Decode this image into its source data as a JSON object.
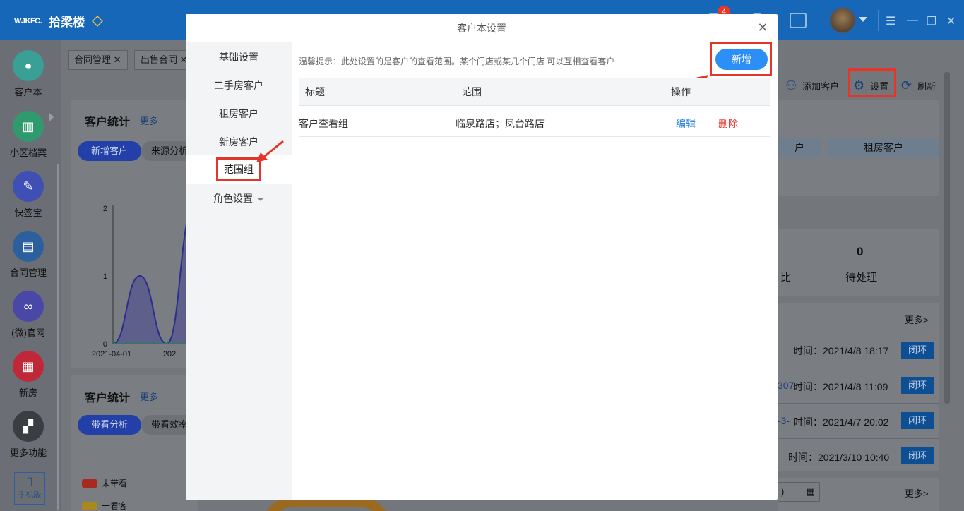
{
  "app": {
    "logo_mark": "WJKFC.",
    "name": "拾梁楼",
    "notification_count": "4"
  },
  "sidebar": {
    "items": [
      {
        "label": "客户本",
        "icon": "user-icon",
        "color": "#3a9f95"
      },
      {
        "label": "小区档案",
        "icon": "map-icon",
        "color": "#2e9a6e"
      },
      {
        "label": "快签宝",
        "icon": "pen-icon",
        "color": "#3f4fb3"
      },
      {
        "label": "合同管理",
        "icon": "document-icon",
        "color": "#2b5f9e"
      },
      {
        "label": "(微)官网",
        "icon": "link-icon",
        "color": "#4a48a6"
      },
      {
        "label": "新房",
        "icon": "building-icon",
        "color": "#c0283a"
      },
      {
        "label": "更多功能",
        "icon": "grid-icon",
        "color": "#3a3d42"
      }
    ],
    "phone_label": "手机版"
  },
  "tabs": [
    {
      "label": "合同管理"
    },
    {
      "label": "出售合同"
    }
  ],
  "toolbar": {
    "add_customer": "添加客户",
    "settings": "设置",
    "refresh": "刷新"
  },
  "stats_card_1": {
    "title": "客户统计",
    "more": "更多",
    "pill_active": "新增客户",
    "pill_other": "来源分析"
  },
  "stats_card_2": {
    "title": "客户统计",
    "more": "更多",
    "pill_active": "带看分析",
    "pill_other": "带看效率"
  },
  "chart_data": {
    "type": "area",
    "x": [
      "2021-04-01",
      "2021"
    ],
    "values": [
      0,
      1,
      0,
      2
    ],
    "yticks": [
      "2",
      "1",
      "0"
    ],
    "xticks": [
      "2021-04-01",
      "202"
    ],
    "ylim": [
      0,
      2
    ]
  },
  "legend": [
    {
      "label": "未带看",
      "color": "#c92b1e"
    },
    {
      "label": "一看客",
      "color": "#d4a81c"
    }
  ],
  "right_panel": {
    "tag_1": "户",
    "tag_2": "租房客户",
    "count": "0",
    "pending_label": "待处理",
    "side_char": "比",
    "more": "更多>",
    "more_2": "更多>",
    "rows": [
      {
        "prefix": "",
        "time": "时间：2021/4/8 18:17",
        "button": "闭环"
      },
      {
        "prefix": "307",
        "time": "时间：2021/4/8 11:09",
        "button": "闭环"
      },
      {
        "prefix": "-3-",
        "time": "时间：2021/4/7 20:02",
        "button": "闭环"
      },
      {
        "prefix": "",
        "time": "时间：2021/3/10 10:40",
        "button": "闭环"
      }
    ],
    "date_fragment": ")"
  },
  "modal": {
    "title": "客户本设置",
    "nav": [
      {
        "label": "基础设置"
      },
      {
        "label": "二手房客户"
      },
      {
        "label": "租房客户"
      },
      {
        "label": "新房客户"
      },
      {
        "label": "范围组"
      },
      {
        "label": "角色设置"
      }
    ],
    "tip": "温馨提示：此处设置的是客户的查看范围。某个门店或某几个门店 可以互相查看客户",
    "add_button": "新增",
    "columns": [
      "标题",
      "范围",
      "操作"
    ],
    "rows": [
      {
        "title": "客户查看组",
        "scope": "临泉路店；凤台路店",
        "edit": "编辑",
        "delete": "删除"
      }
    ]
  }
}
